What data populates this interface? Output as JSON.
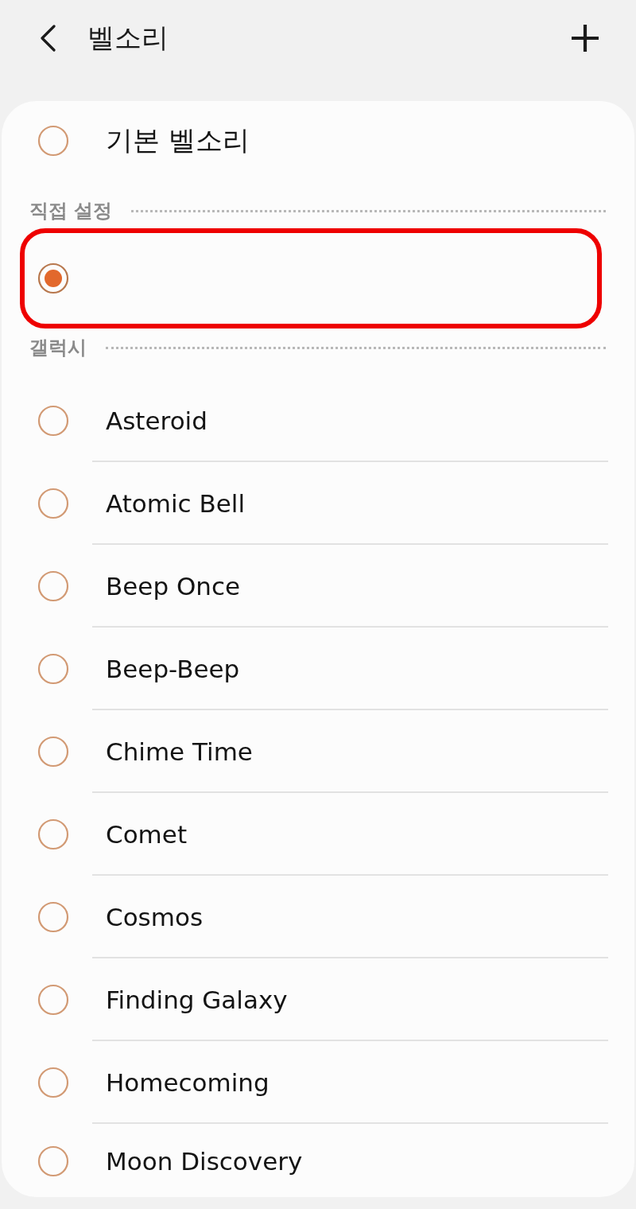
{
  "header": {
    "title": "벨소리"
  },
  "default_item": {
    "label": "기본 벨소리",
    "selected": false
  },
  "sections": [
    {
      "title": "직접 설정",
      "items": [
        {
          "selected": true,
          "highlighted": true
        }
      ]
    },
    {
      "title": "갤럭시",
      "items": [
        {
          "label": "Asteroid",
          "selected": false,
          "highlighted": false
        },
        {
          "label": "Atomic Bell",
          "selected": false,
          "highlighted": false
        },
        {
          "label": "Beep Once",
          "selected": false,
          "highlighted": false
        },
        {
          "label": "Beep-Beep",
          "selected": false,
          "highlighted": false
        },
        {
          "label": "Chime Time",
          "selected": false,
          "highlighted": false
        },
        {
          "label": "Comet",
          "selected": false,
          "highlighted": false
        },
        {
          "label": "Cosmos",
          "selected": false,
          "highlighted": false
        },
        {
          "label": "Finding Galaxy",
          "selected": false,
          "highlighted": false
        },
        {
          "label": "Homecoming",
          "selected": false,
          "highlighted": false
        },
        {
          "label": "Moon Discovery",
          "selected": false,
          "highlighted": false
        }
      ]
    }
  ]
}
